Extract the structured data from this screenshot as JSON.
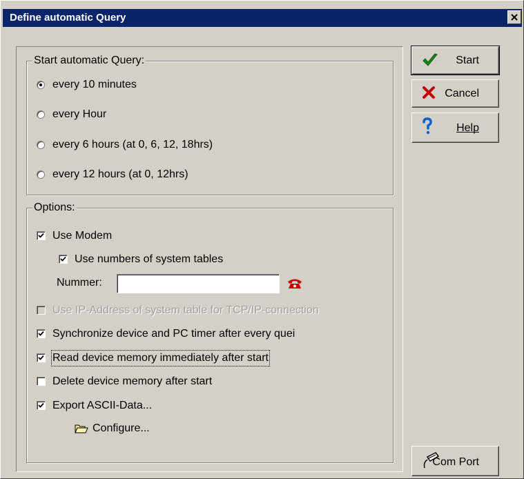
{
  "window": {
    "title": "Define automatic Query",
    "close_glyph": "✕"
  },
  "start_group": {
    "legend": "Start automatic Query:",
    "options": [
      {
        "label": "every 10 minutes",
        "selected": true
      },
      {
        "label": "every Hour",
        "selected": false
      },
      {
        "label": "every 6 hours (at 0, 6, 12, 18hrs)",
        "selected": false
      },
      {
        "label": "every 12 hours (at 0, 12hrs)",
        "selected": false
      }
    ]
  },
  "options_group": {
    "legend": "Options:",
    "use_modem": {
      "label": "Use Modem",
      "checked": true
    },
    "use_numbers": {
      "label": "Use numbers of system tables",
      "checked": true
    },
    "nummer": {
      "label": "Nummer:",
      "value": ""
    },
    "use_ip": {
      "label": "Use IP-Address of system table for TCP/IP-connection",
      "checked": false,
      "disabled": true
    },
    "sync": {
      "label": "Synchronize device and PC timer after every quei",
      "checked": true
    },
    "read_memory": {
      "label": "Read device memory immediately after start",
      "checked": true
    },
    "delete_memory": {
      "label": "Delete device memory after start",
      "checked": false
    },
    "export_ascii": {
      "label": "Export ASCII-Data...",
      "checked": true
    },
    "configure": {
      "label": "Configure...",
      "icon": "folder-open-icon"
    }
  },
  "buttons": {
    "start": {
      "label": "Start",
      "icon": "checkmark-icon",
      "icon_color": "#1f8a1f"
    },
    "cancel": {
      "label": "Cancel",
      "icon": "red-x-icon",
      "icon_color": "#c00000"
    },
    "help": {
      "label": "Help",
      "icon": "question-icon",
      "icon_color": "#1060d0"
    },
    "com_port": {
      "label": "Com Port",
      "icon": "cable-plug-icon"
    }
  },
  "icons": {
    "phone": "phone-icon",
    "phone_color": "#cc0000"
  }
}
